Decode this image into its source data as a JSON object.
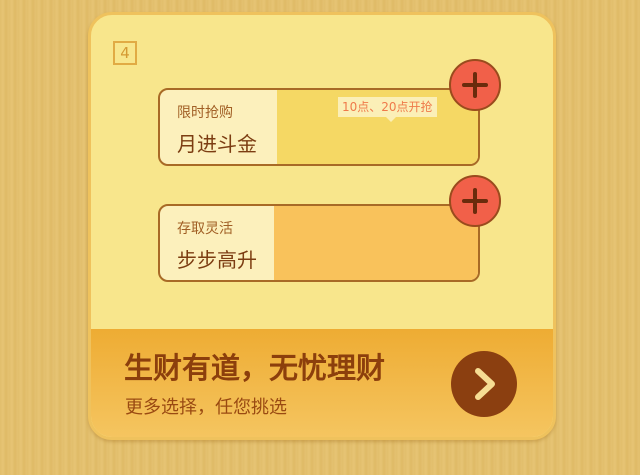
{
  "card": {
    "step_number": "4",
    "products": [
      {
        "sub_label": "限时抢购",
        "main_label": "月进斗金",
        "tooltip": "10点、20点开抢"
      },
      {
        "sub_label": "存取灵活",
        "main_label": "步步高升"
      }
    ],
    "footer": {
      "headline": "生财有道，无忧理财",
      "subline": "更多选择，任您挑选"
    }
  },
  "icons": {
    "add": "plus-icon",
    "go": "chevron-right-icon"
  },
  "colors": {
    "background": "#e2be6c",
    "card": "#f8e68c",
    "accent_button": "#f16049",
    "footer": "#eeac33",
    "text_dark": "#7c3d12"
  }
}
